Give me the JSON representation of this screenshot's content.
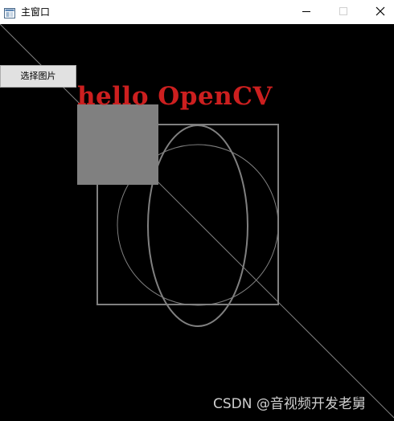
{
  "window": {
    "title": "主窗口",
    "icons": {
      "app": "app-window-icon",
      "minimize": "minimize-icon",
      "maximize": "maximize-icon",
      "close": "close-icon"
    }
  },
  "toolbar": {
    "select_image_label": "选择图片"
  },
  "canvas": {
    "text": "hello OpenCV",
    "colors": {
      "background": "#000000",
      "text": "#cc1f1f",
      "shapes": "#808080",
      "filled_rect": "#808080"
    },
    "shapes": [
      "diagonal-line",
      "filled-square",
      "outline-square",
      "circle",
      "ellipse"
    ]
  },
  "watermark": {
    "text": "CSDN @音视频开发老舅"
  }
}
